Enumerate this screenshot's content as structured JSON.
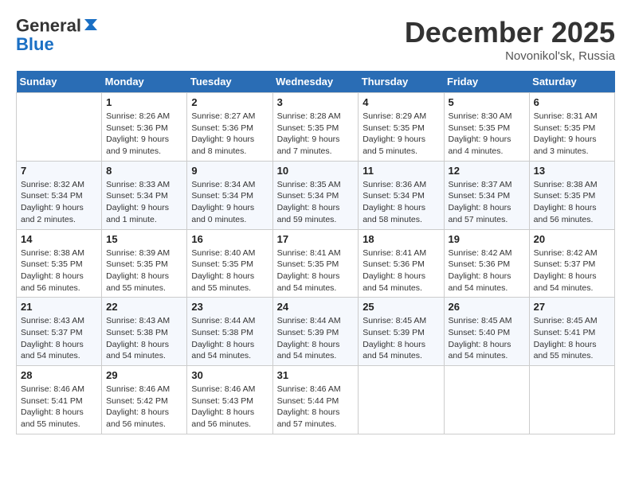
{
  "header": {
    "logo_line1": "General",
    "logo_line2": "Blue",
    "month": "December 2025",
    "location": "Novonikol'sk, Russia"
  },
  "days_of_week": [
    "Sunday",
    "Monday",
    "Tuesday",
    "Wednesday",
    "Thursday",
    "Friday",
    "Saturday"
  ],
  "weeks": [
    [
      {
        "day": "",
        "sunrise": "",
        "sunset": "",
        "daylight": ""
      },
      {
        "day": "1",
        "sunrise": "Sunrise: 8:26 AM",
        "sunset": "Sunset: 5:36 PM",
        "daylight": "Daylight: 9 hours and 9 minutes."
      },
      {
        "day": "2",
        "sunrise": "Sunrise: 8:27 AM",
        "sunset": "Sunset: 5:36 PM",
        "daylight": "Daylight: 9 hours and 8 minutes."
      },
      {
        "day": "3",
        "sunrise": "Sunrise: 8:28 AM",
        "sunset": "Sunset: 5:35 PM",
        "daylight": "Daylight: 9 hours and 7 minutes."
      },
      {
        "day": "4",
        "sunrise": "Sunrise: 8:29 AM",
        "sunset": "Sunset: 5:35 PM",
        "daylight": "Daylight: 9 hours and 5 minutes."
      },
      {
        "day": "5",
        "sunrise": "Sunrise: 8:30 AM",
        "sunset": "Sunset: 5:35 PM",
        "daylight": "Daylight: 9 hours and 4 minutes."
      },
      {
        "day": "6",
        "sunrise": "Sunrise: 8:31 AM",
        "sunset": "Sunset: 5:35 PM",
        "daylight": "Daylight: 9 hours and 3 minutes."
      }
    ],
    [
      {
        "day": "7",
        "sunrise": "Sunrise: 8:32 AM",
        "sunset": "Sunset: 5:34 PM",
        "daylight": "Daylight: 9 hours and 2 minutes."
      },
      {
        "day": "8",
        "sunrise": "Sunrise: 8:33 AM",
        "sunset": "Sunset: 5:34 PM",
        "daylight": "Daylight: 9 hours and 1 minute."
      },
      {
        "day": "9",
        "sunrise": "Sunrise: 8:34 AM",
        "sunset": "Sunset: 5:34 PM",
        "daylight": "Daylight: 9 hours and 0 minutes."
      },
      {
        "day": "10",
        "sunrise": "Sunrise: 8:35 AM",
        "sunset": "Sunset: 5:34 PM",
        "daylight": "Daylight: 8 hours and 59 minutes."
      },
      {
        "day": "11",
        "sunrise": "Sunrise: 8:36 AM",
        "sunset": "Sunset: 5:34 PM",
        "daylight": "Daylight: 8 hours and 58 minutes."
      },
      {
        "day": "12",
        "sunrise": "Sunrise: 8:37 AM",
        "sunset": "Sunset: 5:34 PM",
        "daylight": "Daylight: 8 hours and 57 minutes."
      },
      {
        "day": "13",
        "sunrise": "Sunrise: 8:38 AM",
        "sunset": "Sunset: 5:35 PM",
        "daylight": "Daylight: 8 hours and 56 minutes."
      }
    ],
    [
      {
        "day": "14",
        "sunrise": "Sunrise: 8:38 AM",
        "sunset": "Sunset: 5:35 PM",
        "daylight": "Daylight: 8 hours and 56 minutes."
      },
      {
        "day": "15",
        "sunrise": "Sunrise: 8:39 AM",
        "sunset": "Sunset: 5:35 PM",
        "daylight": "Daylight: 8 hours and 55 minutes."
      },
      {
        "day": "16",
        "sunrise": "Sunrise: 8:40 AM",
        "sunset": "Sunset: 5:35 PM",
        "daylight": "Daylight: 8 hours and 55 minutes."
      },
      {
        "day": "17",
        "sunrise": "Sunrise: 8:41 AM",
        "sunset": "Sunset: 5:35 PM",
        "daylight": "Daylight: 8 hours and 54 minutes."
      },
      {
        "day": "18",
        "sunrise": "Sunrise: 8:41 AM",
        "sunset": "Sunset: 5:36 PM",
        "daylight": "Daylight: 8 hours and 54 minutes."
      },
      {
        "day": "19",
        "sunrise": "Sunrise: 8:42 AM",
        "sunset": "Sunset: 5:36 PM",
        "daylight": "Daylight: 8 hours and 54 minutes."
      },
      {
        "day": "20",
        "sunrise": "Sunrise: 8:42 AM",
        "sunset": "Sunset: 5:37 PM",
        "daylight": "Daylight: 8 hours and 54 minutes."
      }
    ],
    [
      {
        "day": "21",
        "sunrise": "Sunrise: 8:43 AM",
        "sunset": "Sunset: 5:37 PM",
        "daylight": "Daylight: 8 hours and 54 minutes."
      },
      {
        "day": "22",
        "sunrise": "Sunrise: 8:43 AM",
        "sunset": "Sunset: 5:38 PM",
        "daylight": "Daylight: 8 hours and 54 minutes."
      },
      {
        "day": "23",
        "sunrise": "Sunrise: 8:44 AM",
        "sunset": "Sunset: 5:38 PM",
        "daylight": "Daylight: 8 hours and 54 minutes."
      },
      {
        "day": "24",
        "sunrise": "Sunrise: 8:44 AM",
        "sunset": "Sunset: 5:39 PM",
        "daylight": "Daylight: 8 hours and 54 minutes."
      },
      {
        "day": "25",
        "sunrise": "Sunrise: 8:45 AM",
        "sunset": "Sunset: 5:39 PM",
        "daylight": "Daylight: 8 hours and 54 minutes."
      },
      {
        "day": "26",
        "sunrise": "Sunrise: 8:45 AM",
        "sunset": "Sunset: 5:40 PM",
        "daylight": "Daylight: 8 hours and 54 minutes."
      },
      {
        "day": "27",
        "sunrise": "Sunrise: 8:45 AM",
        "sunset": "Sunset: 5:41 PM",
        "daylight": "Daylight: 8 hours and 55 minutes."
      }
    ],
    [
      {
        "day": "28",
        "sunrise": "Sunrise: 8:46 AM",
        "sunset": "Sunset: 5:41 PM",
        "daylight": "Daylight: 8 hours and 55 minutes."
      },
      {
        "day": "29",
        "sunrise": "Sunrise: 8:46 AM",
        "sunset": "Sunset: 5:42 PM",
        "daylight": "Daylight: 8 hours and 56 minutes."
      },
      {
        "day": "30",
        "sunrise": "Sunrise: 8:46 AM",
        "sunset": "Sunset: 5:43 PM",
        "daylight": "Daylight: 8 hours and 56 minutes."
      },
      {
        "day": "31",
        "sunrise": "Sunrise: 8:46 AM",
        "sunset": "Sunset: 5:44 PM",
        "daylight": "Daylight: 8 hours and 57 minutes."
      },
      {
        "day": "",
        "sunrise": "",
        "sunset": "",
        "daylight": ""
      },
      {
        "day": "",
        "sunrise": "",
        "sunset": "",
        "daylight": ""
      },
      {
        "day": "",
        "sunrise": "",
        "sunset": "",
        "daylight": ""
      }
    ]
  ]
}
